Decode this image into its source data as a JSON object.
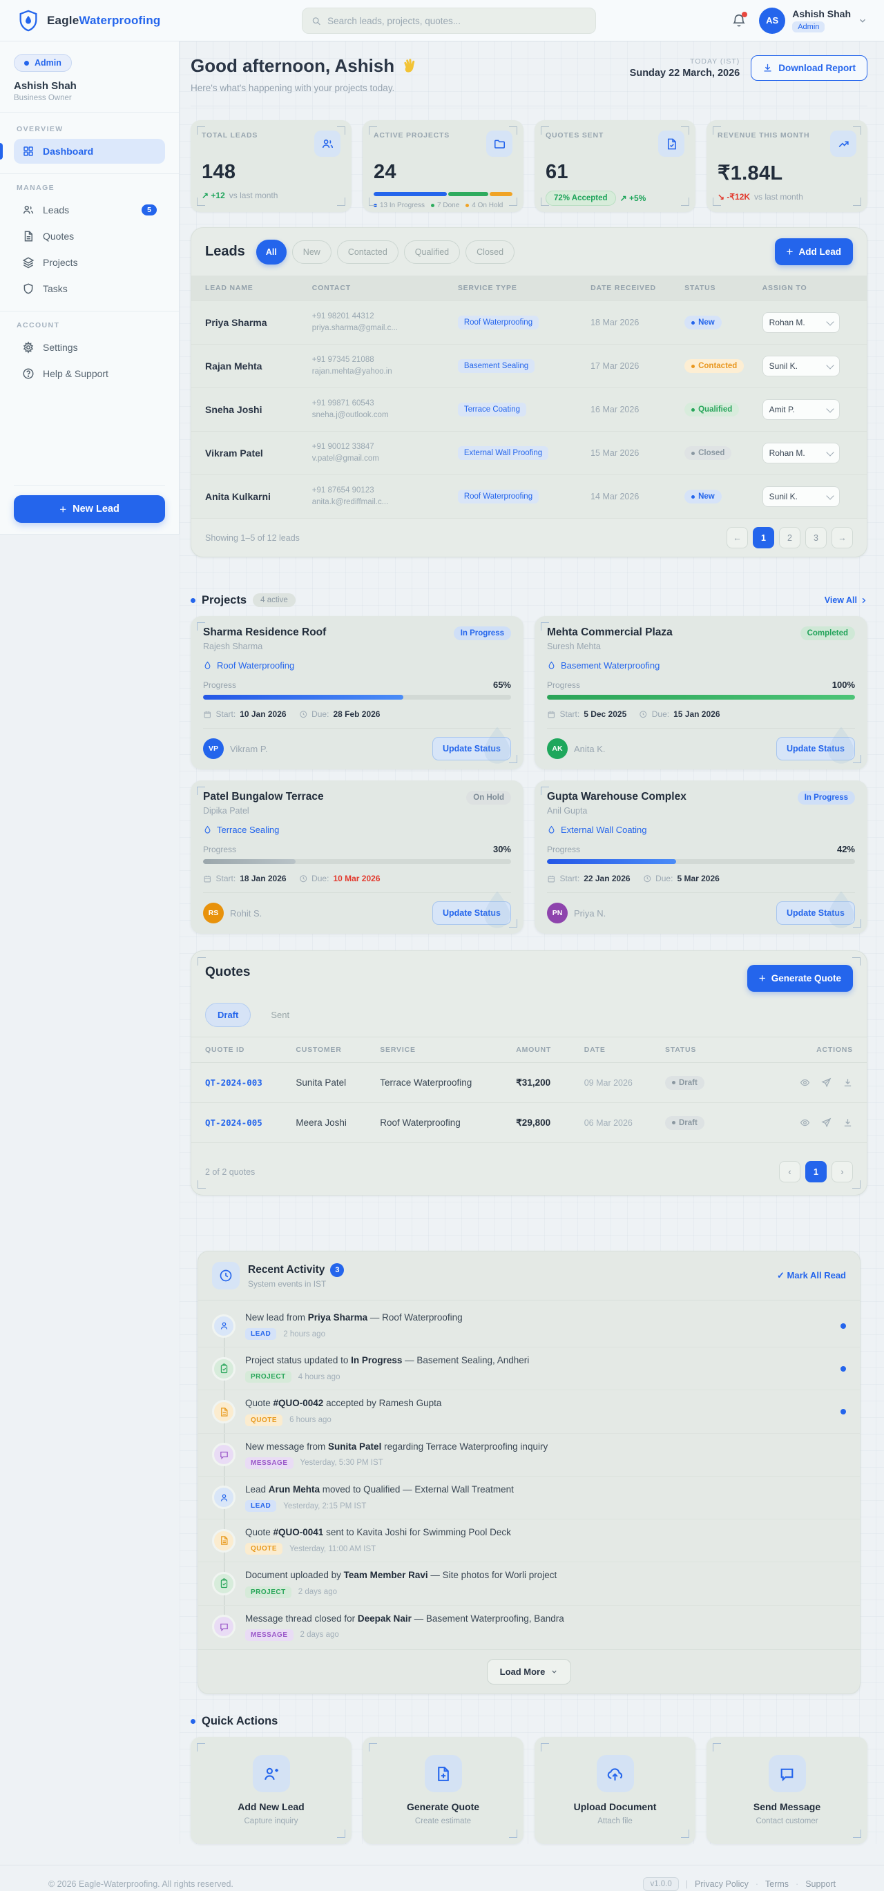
{
  "colors": {
    "accent": "#2465ec",
    "success": "#1da45a",
    "warning": "#e8961e",
    "danger": "#e23a2e",
    "purple": "#9b59c9"
  },
  "brand": {
    "name_part1": "Eagle",
    "name_part2": "Waterproofing"
  },
  "header": {
    "search_placeholder": "Search leads, projects, quotes...",
    "user_name": "Ashish Shah",
    "user_role": "Admin",
    "avatar_initials": "AS"
  },
  "sidebar": {
    "role_badge": "Admin",
    "user_name": "Ashish Shah",
    "user_title": "Business Owner",
    "sections": [
      {
        "label": "OVERVIEW",
        "items": [
          {
            "label": "Dashboard",
            "icon": "dashboard",
            "active": true
          }
        ]
      },
      {
        "label": "MANAGE",
        "items": [
          {
            "label": "Leads",
            "icon": "users",
            "badge": "5"
          },
          {
            "label": "Quotes",
            "icon": "file"
          },
          {
            "label": "Projects",
            "icon": "layers"
          },
          {
            "label": "Tasks",
            "icon": "shield"
          }
        ]
      },
      {
        "label": "ACCOUNT",
        "items": [
          {
            "label": "Settings",
            "icon": "gear"
          },
          {
            "label": "Help & Support",
            "icon": "help"
          }
        ]
      }
    ],
    "new_lead_button": "New Lead"
  },
  "greeting": {
    "title": "Good afternoon, Ashish",
    "emoji": "👋",
    "subtitle": "Here's what's happening with your projects today.",
    "today_label": "TODAY (IST)",
    "date": "Sunday 22 March, 2026",
    "download_button": "Download Report"
  },
  "stats": [
    {
      "label": "TOTAL LEADS",
      "value": "148",
      "icon": "users",
      "delta": "↗ +12",
      "delta_dir": "up",
      "delta_suffix": "vs last month"
    },
    {
      "label": "ACTIVE PROJECTS",
      "value": "24",
      "icon": "folder",
      "segments": [
        {
          "color": "#2465ec",
          "pct": 54
        },
        {
          "color": "#2eab5e",
          "pct": 29
        },
        {
          "color": "#f0a325",
          "pct": 17
        }
      ],
      "legend": [
        {
          "color": "#2465ec",
          "text": "13 In Progress"
        },
        {
          "color": "#2eab5e",
          "text": "7 Done"
        },
        {
          "color": "#f0a325",
          "text": "4 On Hold"
        }
      ]
    },
    {
      "label": "QUOTES SENT",
      "value": "61",
      "icon": "filecheck",
      "accept_badge": "72% Accepted",
      "delta": "↗ +5%",
      "delta_dir": "up"
    },
    {
      "label": "REVENUE THIS MONTH",
      "value": "₹1.84L",
      "icon": "trend",
      "delta": "↘ -₹12K",
      "delta_dir": "down",
      "delta_suffix": "vs last month"
    }
  ],
  "leads": {
    "title": "Leads",
    "filters": [
      "All",
      "New",
      "Contacted",
      "Qualified",
      "Closed"
    ],
    "active_filter": "All",
    "add_button": "Add Lead",
    "columns": [
      "LEAD NAME",
      "CONTACT",
      "SERVICE TYPE",
      "DATE RECEIVED",
      "STATUS",
      "ASSIGN TO"
    ],
    "rows": [
      {
        "name": "Priya Sharma",
        "phone": "+91 98201 44312",
        "email": "priya.sharma@gmail.c...",
        "service": "Roof Waterproofing",
        "date": "18 Mar 2026",
        "status": "New",
        "variant": "new",
        "assignee": "Rohan M."
      },
      {
        "name": "Rajan Mehta",
        "phone": "+91 97345 21088",
        "email": "rajan.mehta@yahoo.in",
        "service": "Basement Sealing",
        "date": "17 Mar 2026",
        "status": "Contacted",
        "variant": "contacted",
        "assignee": "Sunil K."
      },
      {
        "name": "Sneha Joshi",
        "phone": "+91 99871 60543",
        "email": "sneha.j@outlook.com",
        "service": "Terrace Coating",
        "date": "16 Mar 2026",
        "status": "Qualified",
        "variant": "qualified",
        "assignee": "Amit P."
      },
      {
        "name": "Vikram Patel",
        "phone": "+91 90012 33847",
        "email": "v.patel@gmail.com",
        "service": "External Wall Proofing",
        "date": "15 Mar 2026",
        "status": "Closed",
        "variant": "closed",
        "assignee": "Rohan M."
      },
      {
        "name": "Anita Kulkarni",
        "phone": "+91 87654 90123",
        "email": "anita.k@rediffmail.c...",
        "service": "Roof Waterproofing",
        "date": "14 Mar 2026",
        "status": "New",
        "variant": "new",
        "assignee": "Sunil K."
      }
    ],
    "footer_text": "Showing 1–5 of 12 leads",
    "pagination": {
      "prev": "←",
      "pages": [
        "1",
        "2",
        "3"
      ],
      "active": "1",
      "next": "→"
    }
  },
  "projects": {
    "title": "Projects",
    "count_pill": "4 active",
    "view_all": "View All",
    "cards": [
      {
        "title": "Sharma Residence Roof",
        "client": "Rajesh Sharma",
        "service": "Roof Waterproofing",
        "status": "In Progress",
        "variant": "inprogress",
        "progress_label": "Progress",
        "pct": "65%",
        "pct_num": 65,
        "bar_color": "linear-gradient(90deg,#2457e6,#4b8cf7)",
        "start_label": "Start:",
        "start": "10 Jan 2026",
        "due_label": "Due:",
        "due": "28 Feb 2026",
        "due_overdue": false,
        "initials": "VP",
        "avatar_color": "#2465ec",
        "assignee": "Vikram P.",
        "button": "Update Status"
      },
      {
        "title": "Mehta Commercial Plaza",
        "client": "Suresh Mehta",
        "service": "Basement Waterproofing",
        "status": "Completed",
        "variant": "completed",
        "progress_label": "Progress",
        "pct": "100%",
        "pct_num": 100,
        "bar_color": "linear-gradient(90deg,#2aa457,#4cc477)",
        "start_label": "Start:",
        "start": "5 Dec 2025",
        "due_label": "Due:",
        "due": "15 Jan 2026",
        "due_overdue": false,
        "initials": "AK",
        "avatar_color": "#1ea75c",
        "assignee": "Anita K.",
        "button": "Update Status"
      },
      {
        "title": "Patel Bungalow Terrace",
        "client": "Dipika Patel",
        "service": "Terrace Sealing",
        "status": "On Hold",
        "variant": "onhold",
        "progress_label": "Progress",
        "pct": "30%",
        "pct_num": 30,
        "bar_color": "linear-gradient(90deg,#9aa6ab,#b9c3c7)",
        "start_label": "Start:",
        "start": "18 Jan 2026",
        "due_label": "Due:",
        "due": "10 Mar 2026",
        "due_overdue": true,
        "initials": "RS",
        "avatar_color": "#e8920c",
        "assignee": "Rohit S.",
        "button": "Update Status"
      },
      {
        "title": "Gupta Warehouse Complex",
        "client": "Anil Gupta",
        "service": "External Wall Coating",
        "status": "In Progress",
        "variant": "inprogress",
        "progress_label": "Progress",
        "pct": "42%",
        "pct_num": 42,
        "bar_color": "linear-gradient(90deg,#2457e6,#4b8cf7)",
        "start_label": "Start:",
        "start": "22 Jan 2026",
        "due_label": "Due:",
        "due": "5 Mar 2026",
        "due_overdue": false,
        "initials": "PN",
        "avatar_color": "#8e44ad",
        "assignee": "Priya N.",
        "button": "Update Status"
      }
    ]
  },
  "quotes": {
    "title": "Quotes",
    "generate_button": "Generate Quote",
    "tabs": [
      "Draft",
      "Sent"
    ],
    "active_tab": "Draft",
    "columns": [
      "QUOTE ID",
      "CUSTOMER",
      "SERVICE",
      "AMOUNT",
      "DATE",
      "STATUS",
      "ACTIONS"
    ],
    "rows": [
      {
        "id": "QT-2024-003",
        "customer": "Sunita Patel",
        "service": "Terrace Waterproofing",
        "amount": "₹31,200",
        "date": "09 Mar 2026",
        "status": "Draft",
        "variant": "draft"
      },
      {
        "id": "QT-2024-005",
        "customer": "Meera Joshi",
        "service": "Roof Waterproofing",
        "amount": "₹29,800",
        "date": "06 Mar 2026",
        "status": "Draft",
        "variant": "draft"
      }
    ],
    "footer_text": "2 of 2 quotes",
    "pagination": {
      "prev": "‹",
      "pages": [
        "1"
      ],
      "active": "1",
      "next": "›"
    }
  },
  "activity": {
    "title": "Recent Activity",
    "count": "3",
    "subtitle": "System events in IST",
    "mark_all_read": "✓ Mark All Read",
    "items": [
      {
        "type": "lead",
        "badge": "LEAD",
        "time": "2 hours ago",
        "unread": true,
        "parts": [
          {
            "t": "New lead from "
          },
          {
            "t": "Priya Sharma",
            "b": true
          },
          {
            "t": " — Roof Waterproofing"
          }
        ]
      },
      {
        "type": "project",
        "badge": "PROJECT",
        "time": "4 hours ago",
        "unread": true,
        "parts": [
          {
            "t": "Project status updated to "
          },
          {
            "t": "In Progress",
            "b": true
          },
          {
            "t": " — Basement Sealing, Andheri"
          }
        ]
      },
      {
        "type": "quote",
        "badge": "QUOTE",
        "time": "6 hours ago",
        "unread": true,
        "parts": [
          {
            "t": "Quote "
          },
          {
            "t": "#QUO-0042",
            "b": true
          },
          {
            "t": " accepted by Ramesh Gupta"
          }
        ]
      },
      {
        "type": "message",
        "badge": "MESSAGE",
        "time": "Yesterday, 5:30 PM IST",
        "unread": false,
        "parts": [
          {
            "t": "New message from "
          },
          {
            "t": "Sunita Patel",
            "b": true
          },
          {
            "t": " regarding Terrace Waterproofing inquiry"
          }
        ]
      },
      {
        "type": "lead",
        "badge": "LEAD",
        "time": "Yesterday, 2:15 PM IST",
        "unread": false,
        "parts": [
          {
            "t": "Lead "
          },
          {
            "t": "Arun Mehta",
            "b": true
          },
          {
            "t": " moved to Qualified — External Wall Treatment"
          }
        ]
      },
      {
        "type": "quote",
        "badge": "QUOTE",
        "time": "Yesterday, 11:00 AM IST",
        "unread": false,
        "parts": [
          {
            "t": "Quote "
          },
          {
            "t": "#QUO-0041",
            "b": true
          },
          {
            "t": " sent to Kavita Joshi for Swimming Pool Deck"
          }
        ]
      },
      {
        "type": "project",
        "badge": "PROJECT",
        "time": "2 days ago",
        "unread": false,
        "parts": [
          {
            "t": "Document uploaded by "
          },
          {
            "t": "Team Member Ravi",
            "b": true
          },
          {
            "t": " — Site photos for Worli project"
          }
        ]
      },
      {
        "type": "message",
        "badge": "MESSAGE",
        "time": "2 days ago",
        "unread": false,
        "parts": [
          {
            "t": "Message thread closed for "
          },
          {
            "t": "Deepak Nair",
            "b": true
          },
          {
            "t": " — Basement Waterproofing, Bandra"
          }
        ]
      }
    ],
    "load_more": "Load More"
  },
  "quick_actions": {
    "title": "Quick Actions",
    "cards": [
      {
        "title": "Add New Lead",
        "subtitle": "Capture inquiry",
        "icon": "userplus"
      },
      {
        "title": "Generate Quote",
        "subtitle": "Create estimate",
        "icon": "fileplus"
      },
      {
        "title": "Upload Document",
        "subtitle": "Attach file",
        "icon": "upload"
      },
      {
        "title": "Send Message",
        "subtitle": "Contact customer",
        "icon": "chat"
      }
    ]
  },
  "page_footer": {
    "copyright": "© 2026 Eagle-Waterproofing. All rights reserved.",
    "version": "v1.0.0",
    "links": [
      "Privacy Policy",
      "Terms",
      "Support"
    ]
  }
}
